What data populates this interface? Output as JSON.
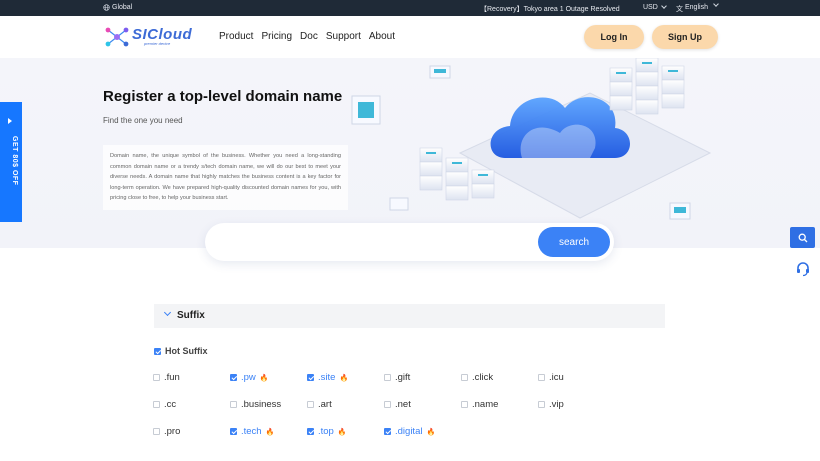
{
  "topbar": {
    "global_label": "Global",
    "notice": "【Recovery】Tokyo area 1 Outage Resolved",
    "currency": "USD",
    "language": "English"
  },
  "header": {
    "logo_text": "SICloud",
    "logo_sub": "premier device",
    "nav": [
      "Product",
      "Pricing",
      "Doc",
      "Support",
      "About"
    ],
    "login_label": "Log In",
    "signup_label": "Sign Up"
  },
  "hero": {
    "title": "Register a top-level domain name",
    "subtitle": "Find the one you need",
    "description": "Domain name, the unique symbol of the business. Whether you need a long-standing common domain name or a trendy s/tech domain name, we will do our best to meet your diverse needs. A domain name that highly matches the business content is a key factor for long-term operation. We have prepared high-quality discounted domain names for you, with pricing close to free, to help your business start."
  },
  "promo": {
    "label": "GET 80$ OFF"
  },
  "search": {
    "placeholder": "",
    "button_label": "search"
  },
  "suffix": {
    "title": "Suffix",
    "hot_label": "Hot Suffix",
    "hot_checked": true,
    "items": [
      {
        "name": ".fun",
        "checked": false,
        "hot": false
      },
      {
        "name": ".pw",
        "checked": true,
        "hot": true
      },
      {
        "name": ".site",
        "checked": true,
        "hot": true
      },
      {
        "name": ".gift",
        "checked": false,
        "hot": false
      },
      {
        "name": ".click",
        "checked": false,
        "hot": false
      },
      {
        "name": ".icu",
        "checked": false,
        "hot": false
      },
      {
        "name": ".cc",
        "checked": false,
        "hot": false
      },
      {
        "name": ".business",
        "checked": false,
        "hot": false
      },
      {
        "name": ".art",
        "checked": false,
        "hot": false
      },
      {
        "name": ".net",
        "checked": false,
        "hot": false
      },
      {
        "name": ".name",
        "checked": false,
        "hot": false
      },
      {
        "name": ".vip",
        "checked": false,
        "hot": false
      },
      {
        "name": ".pro",
        "checked": false,
        "hot": false
      },
      {
        "name": ".tech",
        "checked": true,
        "hot": true
      },
      {
        "name": ".top",
        "checked": true,
        "hot": true
      },
      {
        "name": ".digital",
        "checked": true,
        "hot": true
      }
    ]
  },
  "colors": {
    "accent": "#3b82f6",
    "promo": "#1677ff",
    "pill": "#fbd8ab",
    "topbar": "#1f2a37"
  },
  "icons": [
    "globe-icon",
    "translate-icon",
    "search-icon",
    "headset-icon",
    "fire-icon",
    "chevron-down-icon"
  ]
}
